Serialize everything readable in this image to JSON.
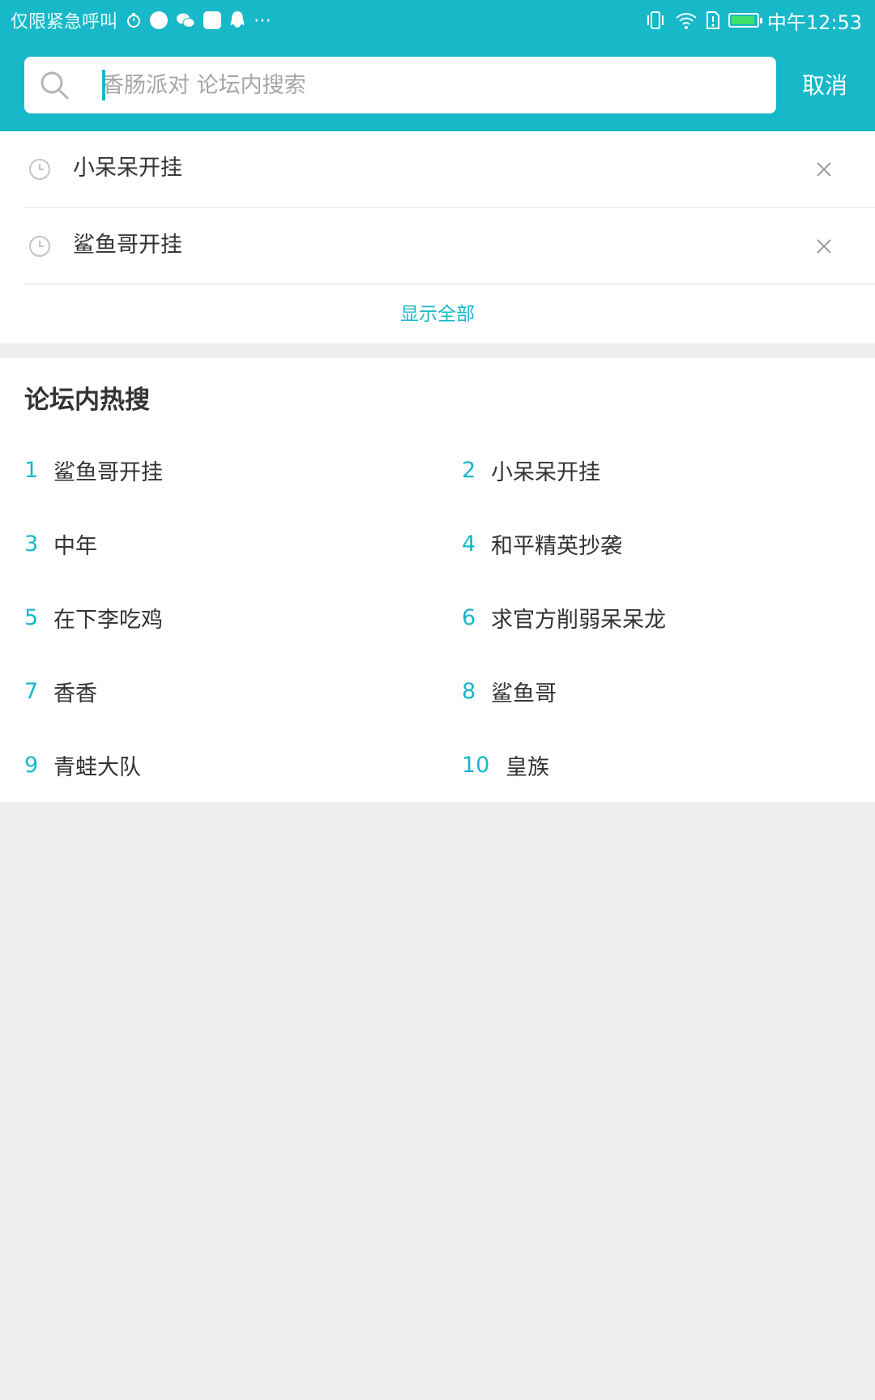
{
  "status_bar": {
    "carrier_text": "仅限紧急呼叫",
    "time": "中午12:53",
    "icons": [
      "timer-icon",
      "app-icon",
      "wechat-icon",
      "video-app-icon",
      "qq-icon",
      "more-notifications-icon",
      "vibrate-icon",
      "wifi-icon",
      "sim-alert-icon",
      "battery-charging-icon"
    ]
  },
  "search": {
    "placeholder": "香肠派对 论坛内搜索",
    "value": "",
    "cancel_label": "取消"
  },
  "history": {
    "items": [
      {
        "label": "小呆呆开挂"
      },
      {
        "label": "鲨鱼哥开挂"
      }
    ],
    "show_all_label": "显示全部"
  },
  "hot_search": {
    "title": "论坛内热搜",
    "items": [
      {
        "rank": "1",
        "label": "鲨鱼哥开挂"
      },
      {
        "rank": "2",
        "label": "小呆呆开挂"
      },
      {
        "rank": "3",
        "label": "中年"
      },
      {
        "rank": "4",
        "label": "和平精英抄袭"
      },
      {
        "rank": "5",
        "label": "在下李吃鸡"
      },
      {
        "rank": "6",
        "label": "求官方削弱呆呆龙"
      },
      {
        "rank": "7",
        "label": "香香"
      },
      {
        "rank": "8",
        "label": "鲨鱼哥"
      },
      {
        "rank": "9",
        "label": "青蛙大队"
      },
      {
        "rank": "10",
        "label": "皇族"
      }
    ]
  },
  "colors": {
    "accent": "#17b8c8",
    "background": "#eeeeee",
    "text": "#333333",
    "placeholder": "#a6a6a6"
  }
}
